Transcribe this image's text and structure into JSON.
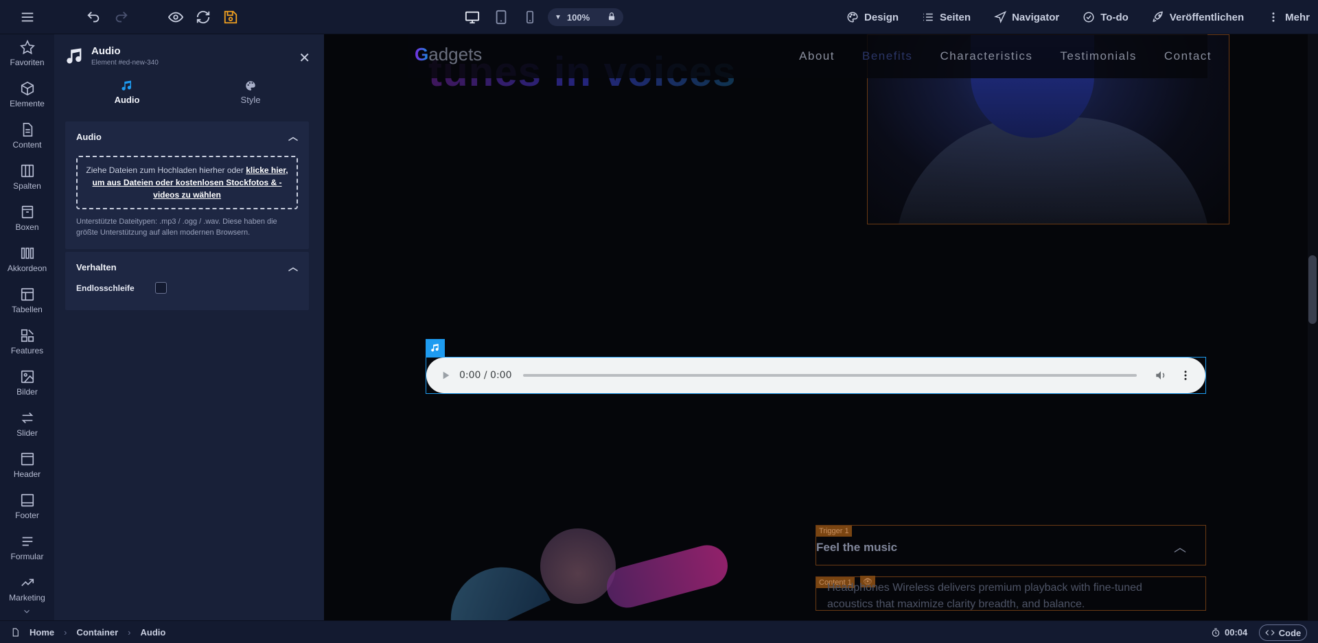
{
  "toolbar": {
    "zoom": "100%",
    "menu": [
      {
        "label": "Design",
        "icon": "palette-icon"
      },
      {
        "label": "Seiten",
        "icon": "list-icon"
      },
      {
        "label": "Navigator",
        "icon": "navigator-icon"
      },
      {
        "label": "To-do",
        "icon": "check-circle-icon"
      },
      {
        "label": "Veröffentlichen",
        "icon": "rocket-icon"
      },
      {
        "label": "Mehr",
        "icon": "kebab-icon"
      }
    ]
  },
  "rail": {
    "items": [
      {
        "label": "Favoriten",
        "icon": "star-icon"
      },
      {
        "label": "Elemente",
        "icon": "cube-icon"
      },
      {
        "label": "Content",
        "icon": "document-icon"
      },
      {
        "label": "Spalten",
        "icon": "columns-icon"
      },
      {
        "label": "Boxen",
        "icon": "box-icon"
      },
      {
        "label": "Akkordeon",
        "icon": "accordion-icon"
      },
      {
        "label": "Tabellen",
        "icon": "table-icon"
      },
      {
        "label": "Features",
        "icon": "features-icon"
      },
      {
        "label": "Bilder",
        "icon": "image-icon"
      },
      {
        "label": "Slider",
        "icon": "swap-icon"
      },
      {
        "label": "Header",
        "icon": "header-icon"
      },
      {
        "label": "Footer",
        "icon": "footer-icon"
      },
      {
        "label": "Formular",
        "icon": "form-icon"
      },
      {
        "label": "Marketing",
        "icon": "trend-icon"
      }
    ]
  },
  "panel": {
    "title": "Audio",
    "subtitle": "Element #ed-new-340",
    "tabs": [
      {
        "label": "Audio",
        "active": true
      },
      {
        "label": "Style",
        "active": false
      }
    ],
    "audio_section": {
      "title": "Audio",
      "dropzone_text": "Ziehe Dateien zum Hochladen hierher oder ",
      "dropzone_link": "klicke hier, um aus Dateien oder kostenlosen Stockfotos & -videos zu wählen",
      "hint": "Unterstützte Dateitypen: .mp3 / .ogg / .wav. Diese haben die größte Unterstützung auf allen modernen Browsern."
    },
    "behavior_section": {
      "title": "Verhalten",
      "loop_label": "Endlosschleife",
      "loop_checked": false
    }
  },
  "canvas": {
    "hero_text": "tunes in voices",
    "logo_first": "G",
    "logo_rest": "adgets",
    "nav": [
      "About",
      "Benefits",
      "Characteristics",
      "Testimonials",
      "Contact"
    ],
    "nav_active": "Benefits",
    "audio_time": "0:00 / 0:00",
    "accordion_trigger_tag": "Trigger 1",
    "accordion_title": "Feel the music",
    "content_tag": "Content 1",
    "content_text": "Headphones Wireless delivers premium playback with fine-tuned acoustics that maximize clarity breadth, and balance."
  },
  "bottombar": {
    "breadcrumbs": [
      "Home",
      "Container",
      "Audio"
    ],
    "timer": "00:04",
    "code_label": "Code"
  }
}
